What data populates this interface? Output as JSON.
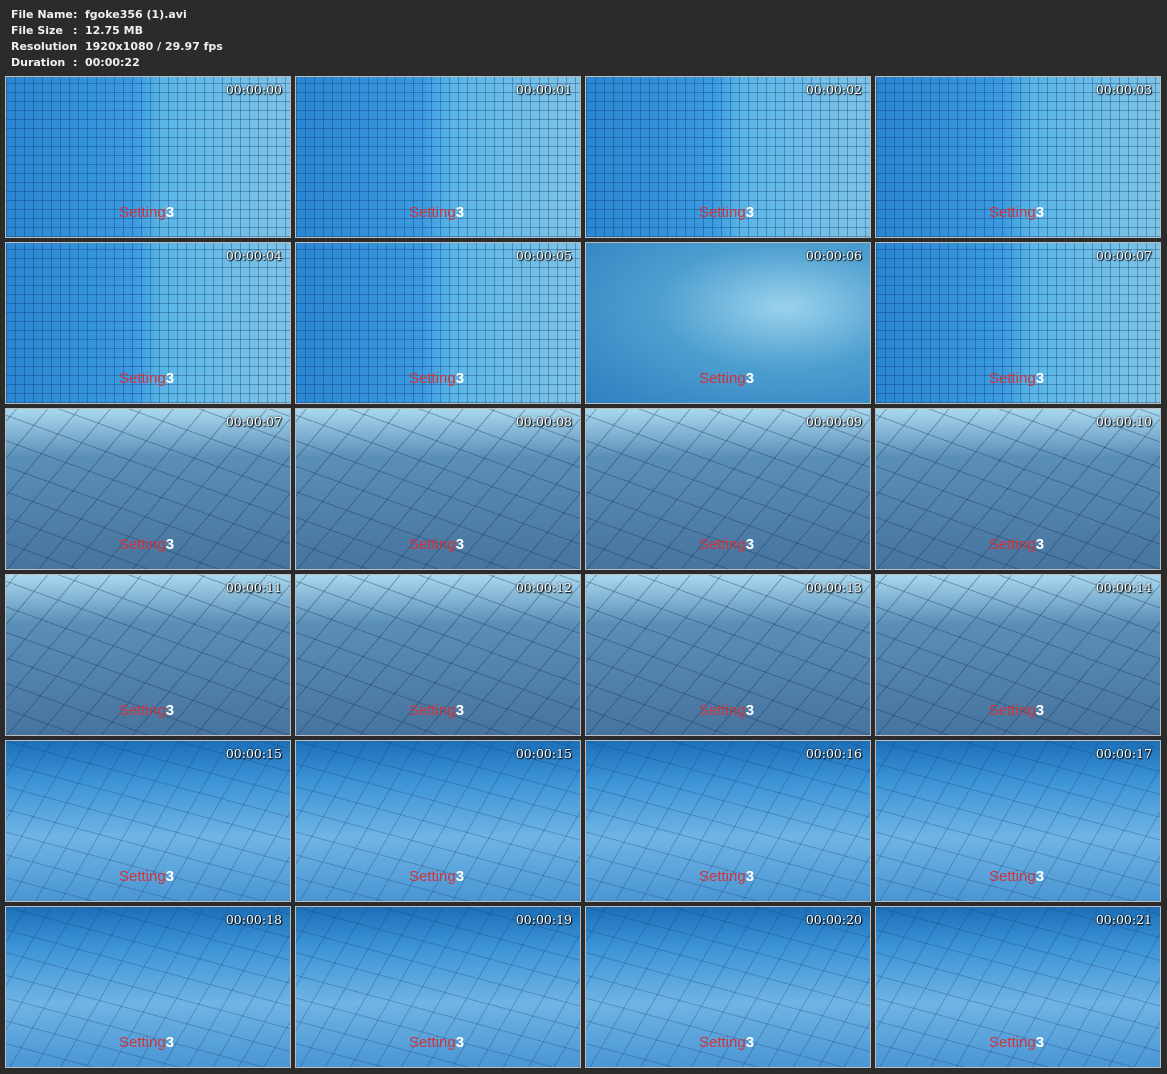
{
  "info": [
    {
      "key": "File Name",
      "value": "fgoke356 (1).avi"
    },
    {
      "key": "File Size",
      "value": "12.75 MB"
    },
    {
      "key": "Resolution",
      "value": "1920x1080 / 29.97 fps"
    },
    {
      "key": "Duration",
      "value": "00:00:22"
    }
  ],
  "separator": ":",
  "watermark": {
    "word": "Setting",
    "num": "3"
  },
  "thumbnails": [
    "00:00:00",
    "00:00:01",
    "00:00:02",
    "00:00:03",
    "00:00:04",
    "00:00:05",
    "00:00:06",
    "00:00:07",
    "00:00:07",
    "00:00:08",
    "00:00:09",
    "00:00:10",
    "00:00:11",
    "00:00:12",
    "00:00:13",
    "00:00:14",
    "00:00:15",
    "00:00:15",
    "00:00:16",
    "00:00:17",
    "00:00:18",
    "00:00:19",
    "00:00:20",
    "00:00:21"
  ]
}
